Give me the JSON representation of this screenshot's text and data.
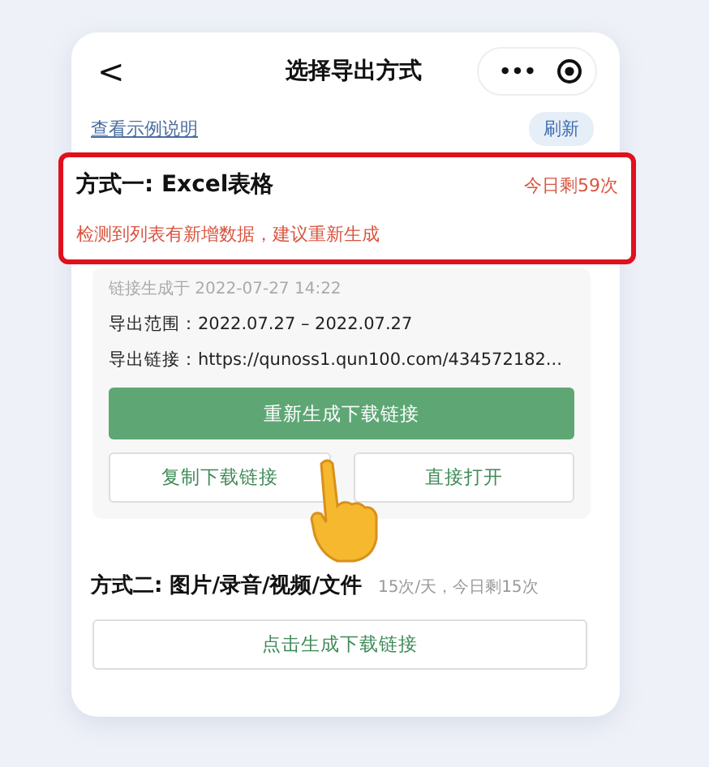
{
  "header": {
    "back": "<",
    "title": "选择导出方式",
    "more": "•••"
  },
  "toolbar": {
    "help_link": "查看示例说明",
    "refresh_button": "刷新"
  },
  "method_one": {
    "title": "方式一: Excel表格",
    "remaining": "今日剩59次",
    "warning": "检测到列表有新增数据，建议重新生成",
    "highlighted": true,
    "generated": "链接生成于 2022-07-27 14:22",
    "range": "导出范围：2022.07.27 – 2022.07.27",
    "link": "导出链接：https://qunoss1.qun100.com/434572182...",
    "buttons": [
      {
        "label": "重新生成下载链接",
        "kind": "primary"
      },
      {
        "label": "复制下载链接",
        "kind": "secondary"
      },
      {
        "label": "直接打开",
        "kind": "secondary"
      }
    ]
  },
  "method_two": {
    "title": "方式二: 图片/录音/视频/文件",
    "quota": "15次/天，今日剩15次",
    "button": "点击生成下载链接"
  }
}
